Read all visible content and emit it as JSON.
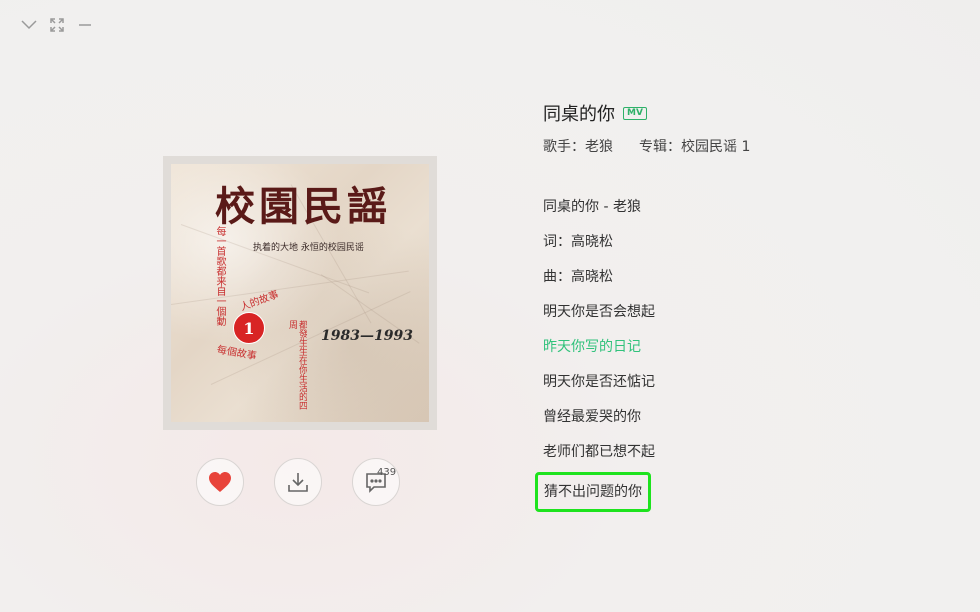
{
  "window_controls": {
    "collapse": "chevron-down-icon",
    "fullscreen": "fullscreen-icon",
    "minimize": "minimize-icon"
  },
  "song": {
    "title": "同桌的你",
    "mv_badge": "MV",
    "artist_text": "歌手：老狼",
    "album_text": "专辑：校园民谣 1"
  },
  "cover": {
    "title": "校園民謡",
    "subtitle": "执着的大地   永恒的校园民谣",
    "vertical_text": "每一首歌都来自一個動",
    "story1": "人的故事",
    "circle_number": "1",
    "story2": "每個故事",
    "vertical_text2": "都發生生在你生活的四周",
    "years": "1983—1993"
  },
  "actions": {
    "like_icon": "heart-icon",
    "download_icon": "download-icon",
    "comment_icon": "comment-icon",
    "comment_count": "439"
  },
  "lyrics": [
    "同桌的你 - 老狼",
    "词：高晓松",
    "曲：高晓松",
    "明天你是否会想起",
    "昨天你写的日记",
    "明天你是否还惦记",
    "曾经最爱哭的你",
    "老师们都已想不起",
    "猜不出问题的你"
  ],
  "colors": {
    "active_lyric": "#31c27c",
    "like": "#e8433a",
    "highlight_box": "#1ee31e"
  }
}
